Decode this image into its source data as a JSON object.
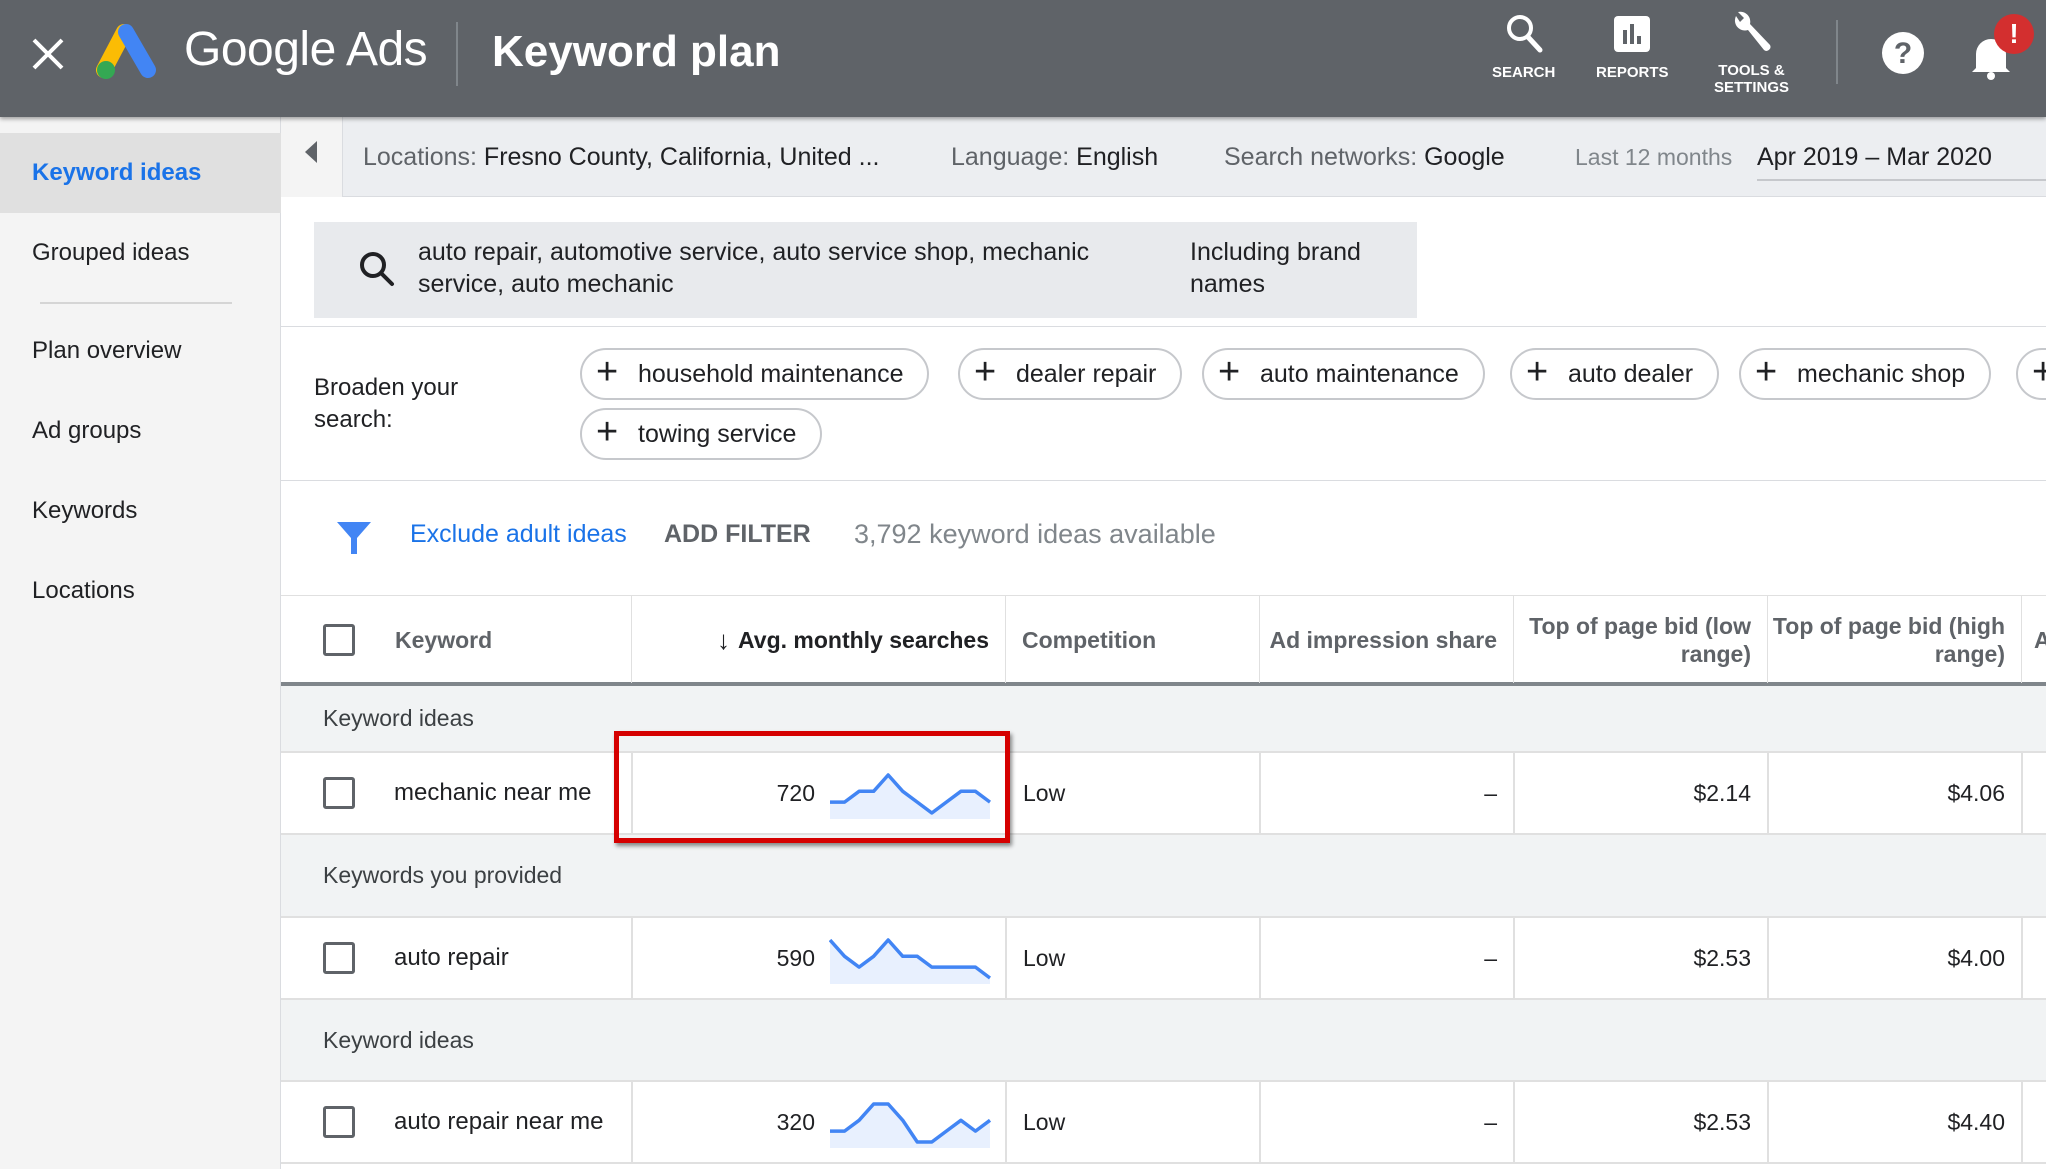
{
  "topbar": {
    "brand": "Google Ads",
    "page_title": "Keyword plan",
    "actions": [
      {
        "label": "SEARCH",
        "icon": "search-icon"
      },
      {
        "label": "REPORTS",
        "icon": "reports-icon"
      },
      {
        "label": "TOOLS &\nSETTINGS",
        "icon": "wrench-icon"
      }
    ],
    "help_icon": "help-icon",
    "notifications_icon": "bell-icon",
    "notification_badge": "!"
  },
  "sidebar": {
    "items": [
      {
        "label": "Keyword ideas",
        "active": true
      },
      {
        "label": "Grouped ideas"
      },
      {
        "label": "Plan overview"
      },
      {
        "label": "Ad groups"
      },
      {
        "label": "Keywords"
      },
      {
        "label": "Locations"
      }
    ]
  },
  "filterbar": {
    "locations_label": "Locations:",
    "locations_value": "Fresno County, California, United ...",
    "language_label": "Language:",
    "language_value": "English",
    "networks_label": "Search networks:",
    "networks_value": "Google",
    "period_label": "Last 12 months",
    "date_range": "Apr 2019 – Mar 2020"
  },
  "search": {
    "query": "auto repair, automotive service, auto service shop, mechanic service, auto mechanic",
    "brand_option": "Including brand names"
  },
  "broaden": {
    "label": "Broaden your search:",
    "chips": [
      "household maintenance",
      "dealer repair",
      "auto maintenance",
      "auto dealer",
      "mechanic shop",
      "",
      "towing service"
    ]
  },
  "filters": {
    "exclude_adult": "Exclude adult ideas",
    "add_filter": "ADD FILTER",
    "ideas_count": "3,792 keyword ideas available"
  },
  "table": {
    "columns": [
      "Keyword",
      "Avg. monthly searches",
      "Competition",
      "Ad impression share",
      "Top of page bid (low range)",
      "Top of page bid (high range)",
      "A"
    ],
    "sort_column": "Avg. monthly searches",
    "sort_direction": "descending",
    "groups": [
      {
        "label": "Keyword ideas",
        "rows": [
          {
            "keyword": "mechanic near me",
            "avg_monthly_searches": "720",
            "trend": [
              2,
              2,
              4,
              4,
              7,
              4,
              2,
              0,
              2,
              4,
              4,
              2
            ],
            "competition": "Low",
            "ad_impression_share": "–",
            "bid_low": "$2.14",
            "bid_high": "$4.06"
          }
        ]
      },
      {
        "label": "Keywords you provided",
        "rows": [
          {
            "keyword": "auto repair",
            "avg_monthly_searches": "590",
            "trend": [
              8,
              5,
              3,
              5,
              8,
              5,
              5,
              3,
              3,
              3,
              3,
              1
            ],
            "competition": "Low",
            "ad_impression_share": "–",
            "bid_low": "$2.53",
            "bid_high": "$4.00"
          }
        ]
      },
      {
        "label": "Keyword ideas",
        "rows": [
          {
            "keyword": "auto repair near me",
            "avg_monthly_searches": "320",
            "trend": [
              2,
              2,
              4,
              7,
              7,
              4,
              0,
              0,
              2,
              4,
              2,
              4
            ],
            "competition": "Low",
            "ad_impression_share": "–",
            "bid_low": "$2.53",
            "bid_high": "$4.40"
          }
        ]
      }
    ]
  },
  "colors": {
    "topbar": "#5f6368",
    "accent": "#1a73e8",
    "sparkline": "#4285f4",
    "sparkline_fill": "#e8f0fe",
    "highlight": "#d50000"
  }
}
